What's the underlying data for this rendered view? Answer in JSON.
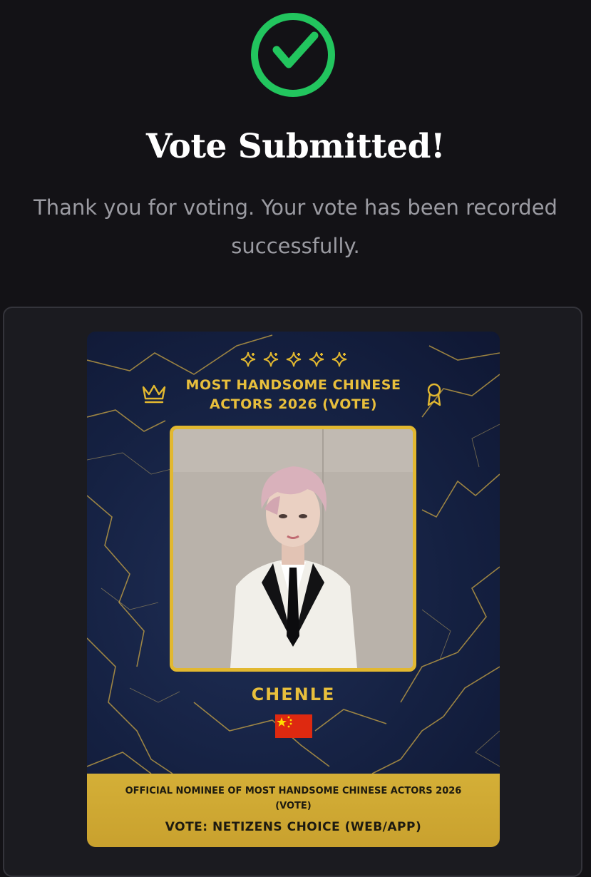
{
  "status": {
    "icon": "check-circle-icon",
    "accent_color": "#22c55e",
    "title": "Vote Submitted!",
    "message_line1": "Thank you for voting. Your vote has been recorded",
    "message_line2": "successfully."
  },
  "card": {
    "stars_icon": "sparkle-icon",
    "crown_icon": "crown-icon",
    "award_icon": "award-ribbon-icon",
    "title_line1": "MOST HANDSOME CHINESE",
    "title_line2": "ACTORS 2026 (VOTE)",
    "photo_icon": "nominee-photo",
    "nominee_name": "CHENLE",
    "flag_icon": "china-flag-icon",
    "gold_color": "#e2b830",
    "footer_line1": "OFFICIAL NOMINEE OF MOST HANDSOME CHINESE ACTORS 2026",
    "footer_line1b": "(VOTE)",
    "footer_line2": "VOTE: NETIZENS CHOICE (WEB/APP)"
  }
}
